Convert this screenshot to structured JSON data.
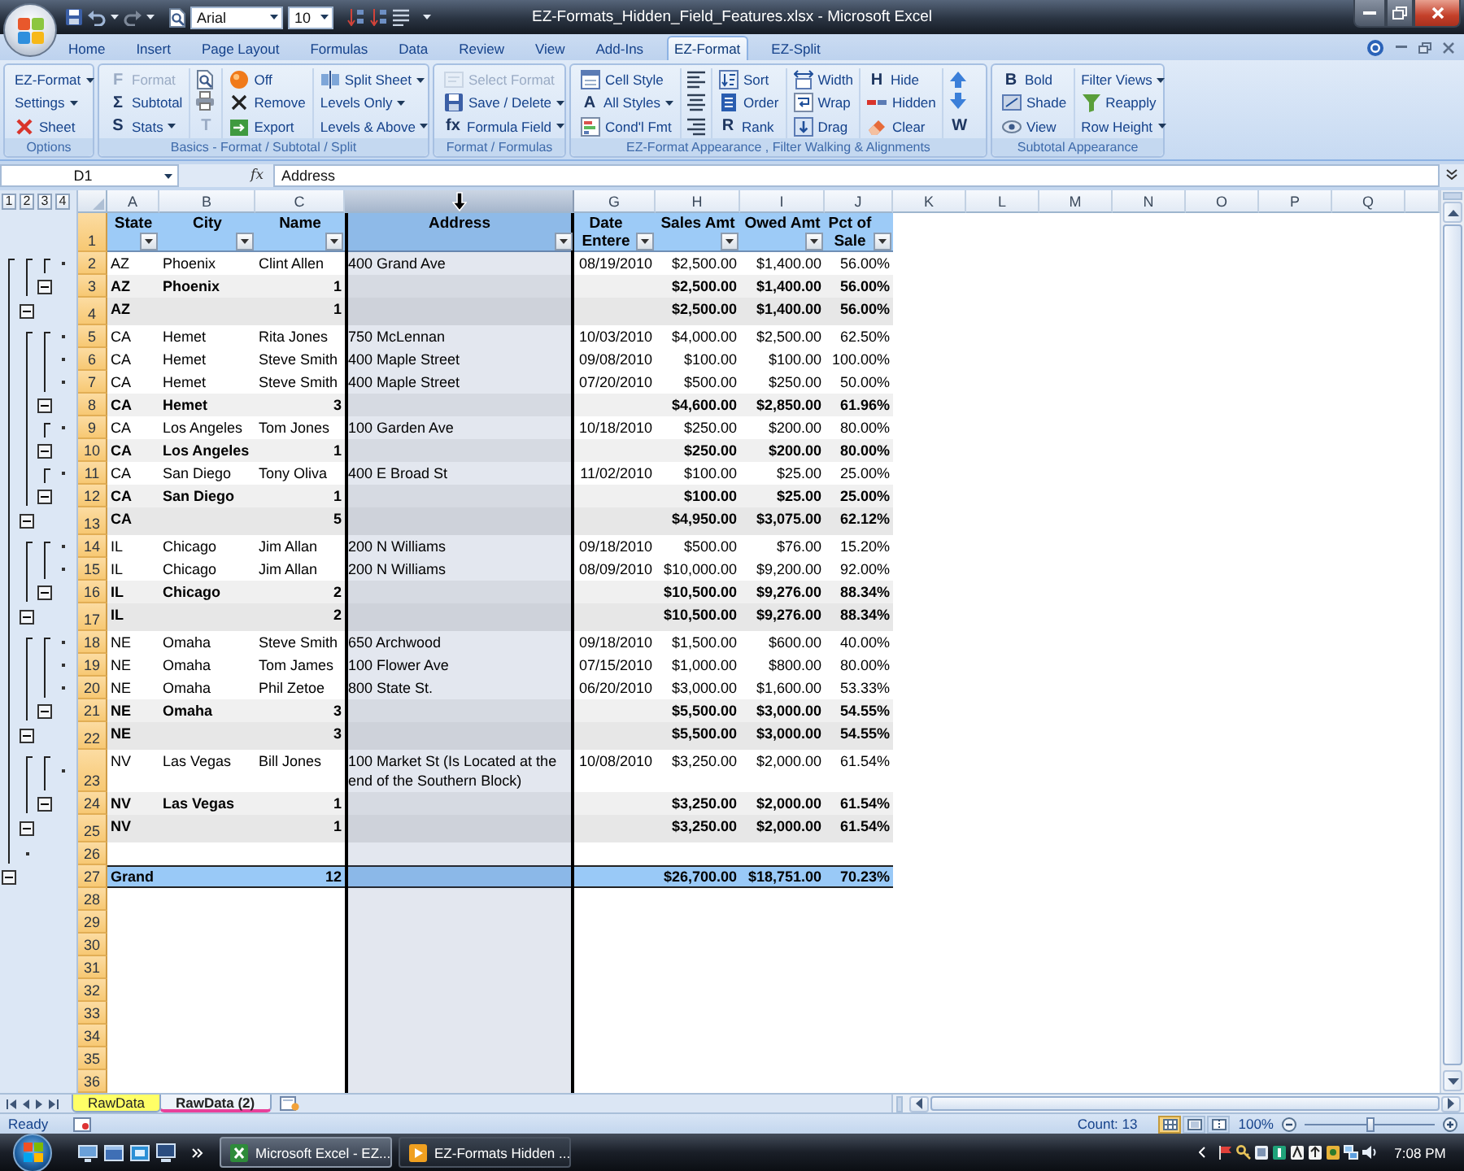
{
  "window": {
    "title": "EZ-Formats_Hidden_Field_Features.xlsx - Microsoft Excel"
  },
  "quick_access": {
    "font": "Arial",
    "font_size": "10"
  },
  "tabs": [
    {
      "label": "Home",
      "selected": false
    },
    {
      "label": "Insert",
      "selected": false
    },
    {
      "label": "Page Layout",
      "selected": false
    },
    {
      "label": "Formulas",
      "selected": false
    },
    {
      "label": "Data",
      "selected": false
    },
    {
      "label": "Review",
      "selected": false
    },
    {
      "label": "View",
      "selected": false
    },
    {
      "label": "Add-Ins",
      "selected": false
    },
    {
      "label": "EZ-Format",
      "selected": true
    },
    {
      "label": "EZ-Split",
      "selected": false
    }
  ],
  "ribbon": {
    "groups": [
      {
        "label": "Options",
        "columns": [
          [
            {
              "label": "EZ-Format",
              "dropdown": true,
              "disabled": false
            },
            {
              "label": "Settings",
              "dropdown": true,
              "disabled": false
            },
            {
              "label": "Sheet",
              "dropdown": false,
              "disabled": false
            }
          ]
        ]
      },
      {
        "label": "Basics - Format / Subtotal / Split",
        "columns": [
          [
            {
              "glyph": "F",
              "label": "Format",
              "dropdown": false,
              "disabled": true
            },
            {
              "glyph": "Σ",
              "label": "Subtotal",
              "dropdown": false,
              "disabled": false
            },
            {
              "glyph": "S",
              "label": "Stats",
              "dropdown": true,
              "disabled": false
            }
          ],
          [
            {
              "dropdown": false,
              "disabled": false
            },
            {
              "dropdown": false,
              "disabled": false
            },
            {
              "glyph": "T",
              "dropdown": false,
              "disabled": true
            }
          ],
          [
            {
              "label": "Off",
              "dropdown": false,
              "disabled": false
            },
            {
              "label": "Remove",
              "dropdown": false,
              "disabled": false
            },
            {
              "label": "Export",
              "dropdown": false,
              "disabled": false
            }
          ],
          [
            {
              "label": "Split Sheet",
              "dropdown": true,
              "disabled": false
            },
            {
              "label": "Levels Only",
              "dropdown": true,
              "disabled": false
            },
            {
              "label": "Levels & Above",
              "dropdown": true,
              "disabled": false
            }
          ]
        ]
      },
      {
        "label": "Format / Formulas",
        "columns": [
          [
            {
              "label": "Select Format",
              "dropdown": false,
              "disabled": true
            },
            {
              "label": "Save / Delete",
              "dropdown": true,
              "disabled": false
            },
            {
              "glyph": "fx",
              "label": "Formula Field",
              "dropdown": true,
              "disabled": false
            }
          ]
        ]
      },
      {
        "label": "EZ-Format Appearance , Filter Walking & Alignments",
        "columns": [
          [
            {
              "label": "Cell Style",
              "dropdown": false,
              "disabled": false
            },
            {
              "glyph": "A",
              "label": "All Styles",
              "dropdown": true,
              "disabled": false
            },
            {
              "label": "Cond'l Fmt",
              "dropdown": false,
              "disabled": false
            }
          ],
          [
            {
              "dropdown": false,
              "disabled": false
            },
            {
              "dropdown": false,
              "disabled": false
            },
            {
              "dropdown": false,
              "disabled": false
            }
          ],
          [
            {
              "label": "Sort",
              "dropdown": false,
              "disabled": false
            },
            {
              "label": "Order",
              "dropdown": false,
              "disabled": false
            },
            {
              "glyph": "R",
              "label": "Rank",
              "dropdown": false,
              "disabled": false
            }
          ],
          [
            {
              "label": "Width",
              "dropdown": false,
              "disabled": false
            },
            {
              "label": "Wrap",
              "dropdown": false,
              "disabled": false
            },
            {
              "label": "Drag",
              "dropdown": false,
              "disabled": false
            }
          ],
          [
            {
              "glyph": "H",
              "label": "Hide",
              "dropdown": false,
              "disabled": false
            },
            {
              "label": "Hidden",
              "dropdown": false,
              "disabled": false
            },
            {
              "label": "Clear",
              "dropdown": false,
              "disabled": false
            }
          ],
          [
            {
              "dropdown": false,
              "disabled": false
            },
            {
              "dropdown": false,
              "disabled": false
            },
            {
              "glyph": "W",
              "dropdown": false,
              "disabled": false
            }
          ]
        ]
      },
      {
        "label": "Subtotal Appearance",
        "columns": [
          [
            {
              "glyph": "B",
              "label": "Bold",
              "dropdown": false,
              "disabled": false
            },
            {
              "label": "Shade",
              "dropdown": false,
              "disabled": false
            },
            {
              "label": "View",
              "dropdown": false,
              "disabled": false
            }
          ],
          [
            {
              "label": "Filter Views",
              "dropdown": true,
              "disabled": false
            },
            {
              "label": "Reapply",
              "dropdown": false,
              "disabled": false
            },
            {
              "label": "Row Height",
              "dropdown": true,
              "disabled": false
            }
          ]
        ]
      }
    ]
  },
  "formula_bar": {
    "name_box": "D1",
    "function_glyph": "fx",
    "formula": "Address"
  },
  "sheet": {
    "outline_levels": [
      "1",
      "2",
      "3",
      "4"
    ],
    "columns": [
      {
        "label": "A",
        "selected": false
      },
      {
        "label": "B",
        "selected": false
      },
      {
        "label": "C",
        "selected": false
      },
      {
        "selected": true
      },
      {
        "label": "G",
        "selected": false
      },
      {
        "label": "H",
        "selected": false
      },
      {
        "label": "I",
        "selected": false
      },
      {
        "label": "J",
        "selected": false
      },
      {
        "label": "K",
        "selected": false
      },
      {
        "label": "L",
        "selected": false
      },
      {
        "label": "M",
        "selected": false
      },
      {
        "label": "N",
        "selected": false
      },
      {
        "label": "O",
        "selected": false
      },
      {
        "label": "P",
        "selected": false
      },
      {
        "label": "Q",
        "selected": false
      }
    ],
    "header_row": {
      "number": "1",
      "cells": {
        "state": "State",
        "city": "City",
        "name": "Name",
        "address": "Address",
        "date": "Date Entere",
        "sales": "Sales Amt",
        "owed": "Owed Amt",
        "pct": "Pct of Sale"
      }
    },
    "outline": [
      {
        "expanded": true,
        "children": [
          {
            "expanded": true,
            "children": [
              {
                "expanded": true,
                "children": [
                  {
                    "number": "2",
                    "cells": {
                      "state": "AZ",
                      "city": "Phoenix",
                      "name": "Clint Allen",
                      "address": "400 Grand Ave",
                      "date": "08/19/2010",
                      "sales": "$2,500.00",
                      "owed": "$1,400.00",
                      "pct": "56.00%"
                    }
                  }
                ],
                "summary": {
                  "number": "3",
                  "cells": {
                    "state": "AZ",
                    "city": "Phoenix",
                    "name": "1",
                    "sales": "$2,500.00",
                    "owed": "$1,400.00",
                    "pct": "56.00%"
                  }
                }
              }
            ],
            "summary": {
              "number": "4",
              "cells": {
                "state": "AZ",
                "name": "1",
                "sales": "$2,500.00",
                "owed": "$1,400.00",
                "pct": "56.00%"
              }
            }
          },
          {
            "expanded": true,
            "children": [
              {
                "expanded": true,
                "children": [
                  {
                    "number": "5",
                    "cells": {
                      "state": "CA",
                      "city": "Hemet",
                      "name": "Rita Jones",
                      "address": "750 McLennan",
                      "date": "10/03/2010",
                      "sales": "$4,000.00",
                      "owed": "$2,500.00",
                      "pct": "62.50%"
                    }
                  },
                  {
                    "number": "6",
                    "cells": {
                      "state": "CA",
                      "city": "Hemet",
                      "name": "Steve Smith",
                      "address": "400 Maple Street",
                      "date": "09/08/2010",
                      "sales": "$100.00",
                      "owed": "$100.00",
                      "pct": "100.00%"
                    }
                  },
                  {
                    "number": "7",
                    "cells": {
                      "state": "CA",
                      "city": "Hemet",
                      "name": "Steve Smith",
                      "address": "400 Maple Street",
                      "date": "07/20/2010",
                      "sales": "$500.00",
                      "owed": "$250.00",
                      "pct": "50.00%"
                    }
                  }
                ],
                "summary": {
                  "number": "8",
                  "cells": {
                    "state": "CA",
                    "city": "Hemet",
                    "name": "3",
                    "sales": "$4,600.00",
                    "owed": "$2,850.00",
                    "pct": "61.96%"
                  }
                }
              },
              {
                "expanded": true,
                "children": [
                  {
                    "number": "9",
                    "cells": {
                      "state": "CA",
                      "city": "Los Angeles",
                      "name": "Tom Jones",
                      "address": "100 Garden Ave",
                      "date": "10/18/2010",
                      "sales": "$250.00",
                      "owed": "$200.00",
                      "pct": "80.00%"
                    }
                  }
                ],
                "summary": {
                  "number": "10",
                  "cells": {
                    "state": "CA",
                    "city": "Los Angeles",
                    "name": "1",
                    "sales": "$250.00",
                    "owed": "$200.00",
                    "pct": "80.00%"
                  }
                }
              },
              {
                "expanded": true,
                "children": [
                  {
                    "number": "11",
                    "cells": {
                      "state": "CA",
                      "city": "San Diego",
                      "name": "Tony Oliva",
                      "address": "400 E Broad St",
                      "date": "11/02/2010",
                      "sales": "$100.00",
                      "owed": "$25.00",
                      "pct": "25.00%"
                    }
                  }
                ],
                "summary": {
                  "number": "12",
                  "cells": {
                    "state": "CA",
                    "city": "San Diego",
                    "name": "1",
                    "sales": "$100.00",
                    "owed": "$25.00",
                    "pct": "25.00%"
                  }
                }
              }
            ],
            "summary": {
              "number": "13",
              "cells": {
                "state": "CA",
                "name": "5",
                "sales": "$4,950.00",
                "owed": "$3,075.00",
                "pct": "62.12%"
              }
            }
          },
          {
            "expanded": true,
            "children": [
              {
                "expanded": true,
                "children": [
                  {
                    "number": "14",
                    "cells": {
                      "state": "IL",
                      "city": "Chicago",
                      "name": "Jim Allan",
                      "address": "200 N Williams",
                      "date": "09/18/2010",
                      "sales": "$500.00",
                      "owed": "$76.00",
                      "pct": "15.20%"
                    }
                  },
                  {
                    "number": "15",
                    "cells": {
                      "state": "IL",
                      "city": "Chicago",
                      "name": "Jim Allan",
                      "address": "200 N Williams",
                      "date": "08/09/2010",
                      "sales": "$10,000.00",
                      "owed": "$9,200.00",
                      "pct": "92.00%"
                    }
                  }
                ],
                "summary": {
                  "number": "16",
                  "cells": {
                    "state": "IL",
                    "city": "Chicago",
                    "name": "2",
                    "sales": "$10,500.00",
                    "owed": "$9,276.00",
                    "pct": "88.34%"
                  }
                }
              }
            ],
            "summary": {
              "number": "17",
              "cells": {
                "state": "IL",
                "name": "2",
                "sales": "$10,500.00",
                "owed": "$9,276.00",
                "pct": "88.34%"
              }
            }
          },
          {
            "expanded": true,
            "children": [
              {
                "expanded": true,
                "children": [
                  {
                    "number": "18",
                    "cells": {
                      "state": "NE",
                      "city": "Omaha",
                      "name": "Steve Smith",
                      "address": "650 Archwood",
                      "date": "09/18/2010",
                      "sales": "$1,500.00",
                      "owed": "$600.00",
                      "pct": "40.00%"
                    }
                  },
                  {
                    "number": "19",
                    "cells": {
                      "state": "NE",
                      "city": "Omaha",
                      "name": "Tom James",
                      "address": "100 Flower Ave",
                      "date": "07/15/2010",
                      "sales": "$1,000.00",
                      "owed": "$800.00",
                      "pct": "80.00%"
                    }
                  },
                  {
                    "number": "20",
                    "cells": {
                      "state": "NE",
                      "city": "Omaha",
                      "name": "Phil Zetoe",
                      "address": "800 State St.",
                      "date": "06/20/2010",
                      "sales": "$3,000.00",
                      "owed": "$1,600.00",
                      "pct": "53.33%"
                    }
                  }
                ],
                "summary": {
                  "number": "21",
                  "cells": {
                    "state": "NE",
                    "city": "Omaha",
                    "name": "3",
                    "sales": "$5,500.00",
                    "owed": "$3,000.00",
                    "pct": "54.55%"
                  }
                }
              }
            ],
            "summary": {
              "number": "22",
              "cells": {
                "state": "NE",
                "name": "3",
                "sales": "$5,500.00",
                "owed": "$3,000.00",
                "pct": "54.55%"
              }
            }
          },
          {
            "expanded": true,
            "children": [
              {
                "expanded": true,
                "children": [
                  {
                    "number": "23",
                    "cells": {
                      "state": "NV",
                      "city": "Las Vegas",
                      "name": "Bill Jones",
                      "address": "100 Market St (Is Located at the end of the Southern Block)",
                      "date": "10/08/2010",
                      "sales": "$3,250.00",
                      "owed": "$2,000.00",
                      "pct": "61.54%"
                    }
                  }
                ],
                "summary": {
                  "number": "24",
                  "cells": {
                    "state": "NV",
                    "city": "Las Vegas",
                    "name": "1",
                    "sales": "$3,250.00",
                    "owed": "$2,000.00",
                    "pct": "61.54%"
                  }
                }
              }
            ],
            "summary": {
              "number": "25",
              "cells": {
                "state": "NV",
                "name": "1",
                "sales": "$3,250.00",
                "owed": "$2,000.00",
                "pct": "61.54%"
              }
            }
          },
          {
            "number": "26"
          }
        ],
        "summary": {
          "number": "27",
          "cells": {
            "state": "Grand",
            "name": "12",
            "sales": "$26,700.00",
            "owed": "$18,751.00",
            "pct": "70.23%"
          }
        }
      }
    ],
    "empty_rows": [
      "28",
      "29",
      "30",
      "31",
      "32",
      "33",
      "34",
      "35",
      "36"
    ]
  },
  "sheet_tabs": [
    {
      "label": "RawData",
      "selected": false,
      "color": "#ffff66"
    },
    {
      "label": "RawData (2)",
      "selected": true,
      "color": "#e8409a"
    }
  ],
  "status_bar": {
    "mode": "Ready",
    "count": "Count: 13",
    "views": [
      {
        "selected": true
      },
      {
        "selected": false
      },
      {
        "selected": false
      }
    ],
    "zoom": "100%",
    "zoom_slider": {
      "level": 0.5
    }
  },
  "taskbar": {
    "buttons": [
      {
        "label": "Microsoft Excel - EZ...",
        "selected": true
      },
      {
        "label": "EZ-Formats Hidden ...",
        "selected": false
      }
    ],
    "clock": "7:08 PM"
  }
}
